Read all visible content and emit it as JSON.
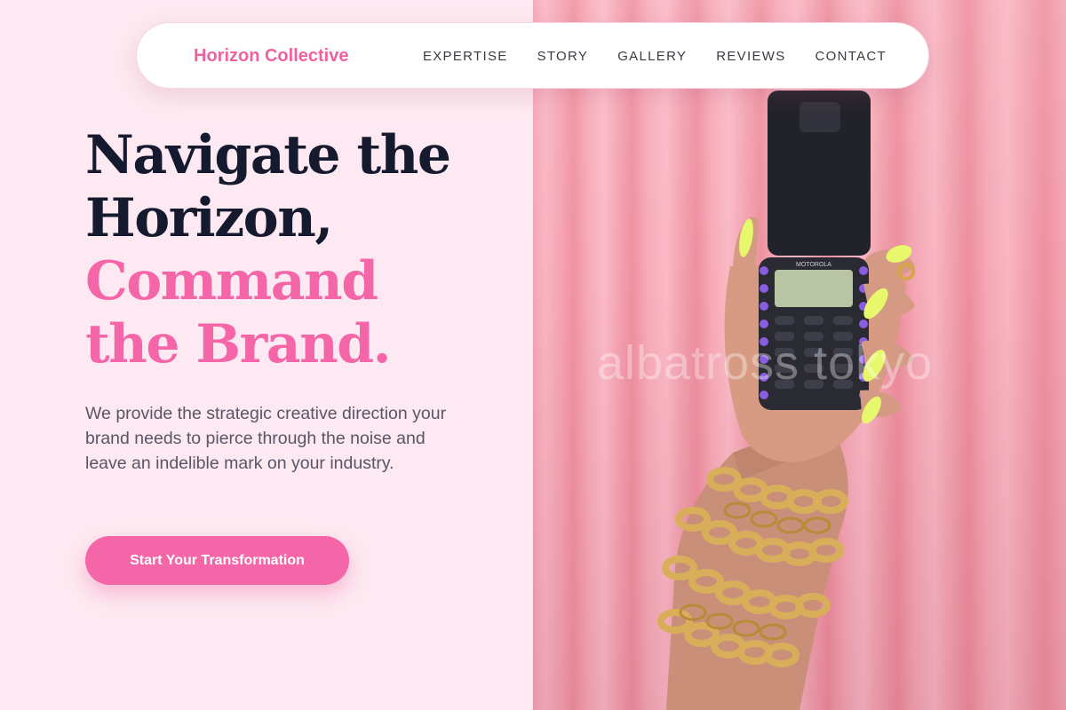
{
  "nav": {
    "brand": "Horizon Collective",
    "links": [
      "EXPERTISE",
      "STORY",
      "GALLERY",
      "REVIEWS",
      "CONTACT"
    ]
  },
  "hero": {
    "headline_lines": [
      "Navigate the",
      "Horizon,"
    ],
    "accent_lines": [
      "Command",
      "the Brand."
    ],
    "lead": "We provide the strategic creative direction your brand needs to pierce through the noise and leave an indelible mark on your industry.",
    "cta_label": "Start Your Transformation"
  },
  "photo": {
    "watermark": "albatross tokyo",
    "phone_brand": "MOTOROLA"
  },
  "colors": {
    "accent": "#f466a8",
    "heading": "#151a2e",
    "left_background": "#fde9f1",
    "body_text": "#5b5566"
  }
}
